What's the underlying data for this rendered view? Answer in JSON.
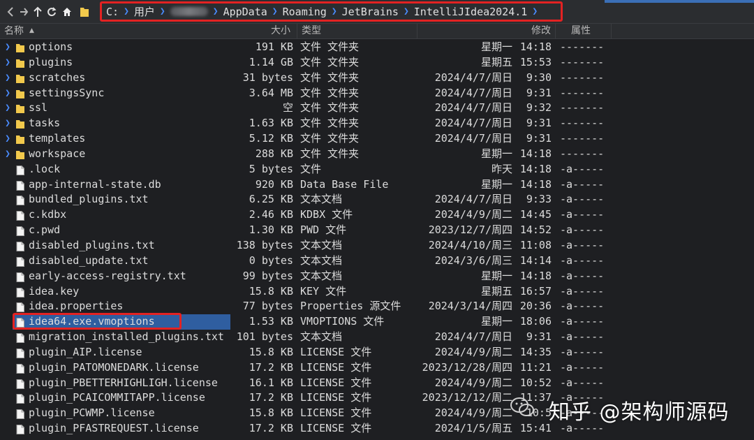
{
  "address_bar": {
    "crumbs": [
      "C:",
      "用户",
      "",
      "AppData",
      "Roaming",
      "JetBrains",
      "IntelliJIdea2024.1"
    ]
  },
  "columns": {
    "name": "名称",
    "size": "大小",
    "type": "类型",
    "modified": "修改",
    "attributes": "属性"
  },
  "files": [
    {
      "name": "options",
      "size": "191 KB",
      "type": "文件 文件夹",
      "day": "星期一",
      "time": "14:18",
      "attr": "-------",
      "is_folder": true
    },
    {
      "name": "plugins",
      "size": "1.14 GB",
      "type": "文件 文件夹",
      "day": "星期五",
      "time": "15:53",
      "attr": "-------",
      "is_folder": true
    },
    {
      "name": "scratches",
      "size": "31 bytes",
      "type": "文件 文件夹",
      "day": "2024/4/7/周日",
      "time": "9:30",
      "attr": "-------",
      "is_folder": true
    },
    {
      "name": "settingsSync",
      "size": "3.64 MB",
      "type": "文件 文件夹",
      "day": "2024/4/7/周日",
      "time": "9:31",
      "attr": "-------",
      "is_folder": true
    },
    {
      "name": "ssl",
      "size": "空",
      "type": "文件 文件夹",
      "day": "2024/4/7/周日",
      "time": "9:32",
      "attr": "-------",
      "is_folder": true
    },
    {
      "name": "tasks",
      "size": "1.63 KB",
      "type": "文件 文件夹",
      "day": "2024/4/7/周日",
      "time": "9:31",
      "attr": "-------",
      "is_folder": true
    },
    {
      "name": "templates",
      "size": "5.12 KB",
      "type": "文件 文件夹",
      "day": "2024/4/7/周日",
      "time": "9:31",
      "attr": "-------",
      "is_folder": true
    },
    {
      "name": "workspace",
      "size": "288 KB",
      "type": "文件 文件夹",
      "day": "星期一",
      "time": "14:18",
      "attr": "-------",
      "is_folder": true
    },
    {
      "name": ".lock",
      "size": "5 bytes",
      "type": "文件",
      "day": "昨天",
      "time": "14:18",
      "attr": "-a-----",
      "is_folder": false
    },
    {
      "name": "app-internal-state.db",
      "size": "920 KB",
      "type": "Data Base File",
      "day": "星期一",
      "time": "14:18",
      "attr": "-a-----",
      "is_folder": false
    },
    {
      "name": "bundled_plugins.txt",
      "size": "6.25 KB",
      "type": "文本文档",
      "day": "2024/4/7/周日",
      "time": "9:33",
      "attr": "-a-----",
      "is_folder": false
    },
    {
      "name": "c.kdbx",
      "size": "2.46 KB",
      "type": "KDBX 文件",
      "day": "2024/4/9/周二",
      "time": "14:45",
      "attr": "-a-----",
      "is_folder": false
    },
    {
      "name": "c.pwd",
      "size": "1.30 KB",
      "type": "PWD 文件",
      "day": "2023/12/7/周四",
      "time": "14:52",
      "attr": "-a-----",
      "is_folder": false
    },
    {
      "name": "disabled_plugins.txt",
      "size": "138 bytes",
      "type": "文本文档",
      "day": "2024/4/10/周三",
      "time": "11:08",
      "attr": "-a-----",
      "is_folder": false
    },
    {
      "name": "disabled_update.txt",
      "size": "0 bytes",
      "type": "文本文档",
      "day": "2024/3/6/周三",
      "time": "14:14",
      "attr": "-a-----",
      "is_folder": false
    },
    {
      "name": "early-access-registry.txt",
      "size": "99 bytes",
      "type": "文本文档",
      "day": "星期一",
      "time": "14:18",
      "attr": "-a-----",
      "is_folder": false
    },
    {
      "name": "idea.key",
      "size": "15.8 KB",
      "type": "KEY 文件",
      "day": "星期五",
      "time": "16:57",
      "attr": "-a-----",
      "is_folder": false
    },
    {
      "name": "idea.properties",
      "size": "77 bytes",
      "type": "Properties 源文件",
      "day": "2024/3/14/周四",
      "time": "20:36",
      "attr": "-a-----",
      "is_folder": false
    },
    {
      "name": "idea64.exe.vmoptions",
      "size": "1.53 KB",
      "type": "VMOPTIONS 文件",
      "day": "星期一",
      "time": "18:06",
      "attr": "-a-----",
      "is_folder": false,
      "selected": true
    },
    {
      "name": "migration_installed_plugins.txt",
      "size": "101 bytes",
      "type": "文本文档",
      "day": "2024/4/7/周日",
      "time": "9:31",
      "attr": "-a-----",
      "is_folder": false
    },
    {
      "name": "plugin_AIP.license",
      "size": "15.8 KB",
      "type": "LICENSE 文件",
      "day": "2024/4/9/周二",
      "time": "14:35",
      "attr": "-a-----",
      "is_folder": false
    },
    {
      "name": "plugin_PATOMONEDARK.license",
      "size": "17.2 KB",
      "type": "LICENSE 文件",
      "day": "2023/12/28/周四",
      "time": "11:21",
      "attr": "-a-----",
      "is_folder": false
    },
    {
      "name": "plugin_PBETTERHIGHLIGH.license",
      "size": "16.1 KB",
      "type": "LICENSE 文件",
      "day": "2024/4/9/周二",
      "time": "10:52",
      "attr": "-a-----",
      "is_folder": false
    },
    {
      "name": "plugin_PCAICOMMITAPP.license",
      "size": "17.2 KB",
      "type": "LICENSE 文件",
      "day": "2023/12/12/周二",
      "time": "11:37",
      "attr": "-a-----",
      "is_folder": false
    },
    {
      "name": "plugin_PCWMP.license",
      "size": "15.8 KB",
      "type": "LICENSE 文件",
      "day": "2024/4/9/周二",
      "time": "10:5",
      "attr": "-a-----",
      "is_folder": false
    },
    {
      "name": "plugin_PFASTREQUEST.license",
      "size": "17.2 KB",
      "type": "LICENSE 文件",
      "day": "2024/1/5/周五",
      "time": "15:41",
      "attr": "-a-----",
      "is_folder": false
    }
  ],
  "watermark": {
    "text": "知乎 @架构师源码"
  },
  "icons": {
    "back": "back-arrow-icon",
    "forward": "forward-arrow-icon",
    "up": "up-arrow-icon",
    "home": "home-icon",
    "folder": "folder-icon",
    "file": "file-icon",
    "expand": "chevron-right-icon",
    "sort": "sort-ascending-icon"
  },
  "colors": {
    "background": "#1e1f22",
    "folder": "#f2c94c",
    "accent": "#4a8cff",
    "selection": "#2f5ea0",
    "highlight_border": "#e32222"
  }
}
